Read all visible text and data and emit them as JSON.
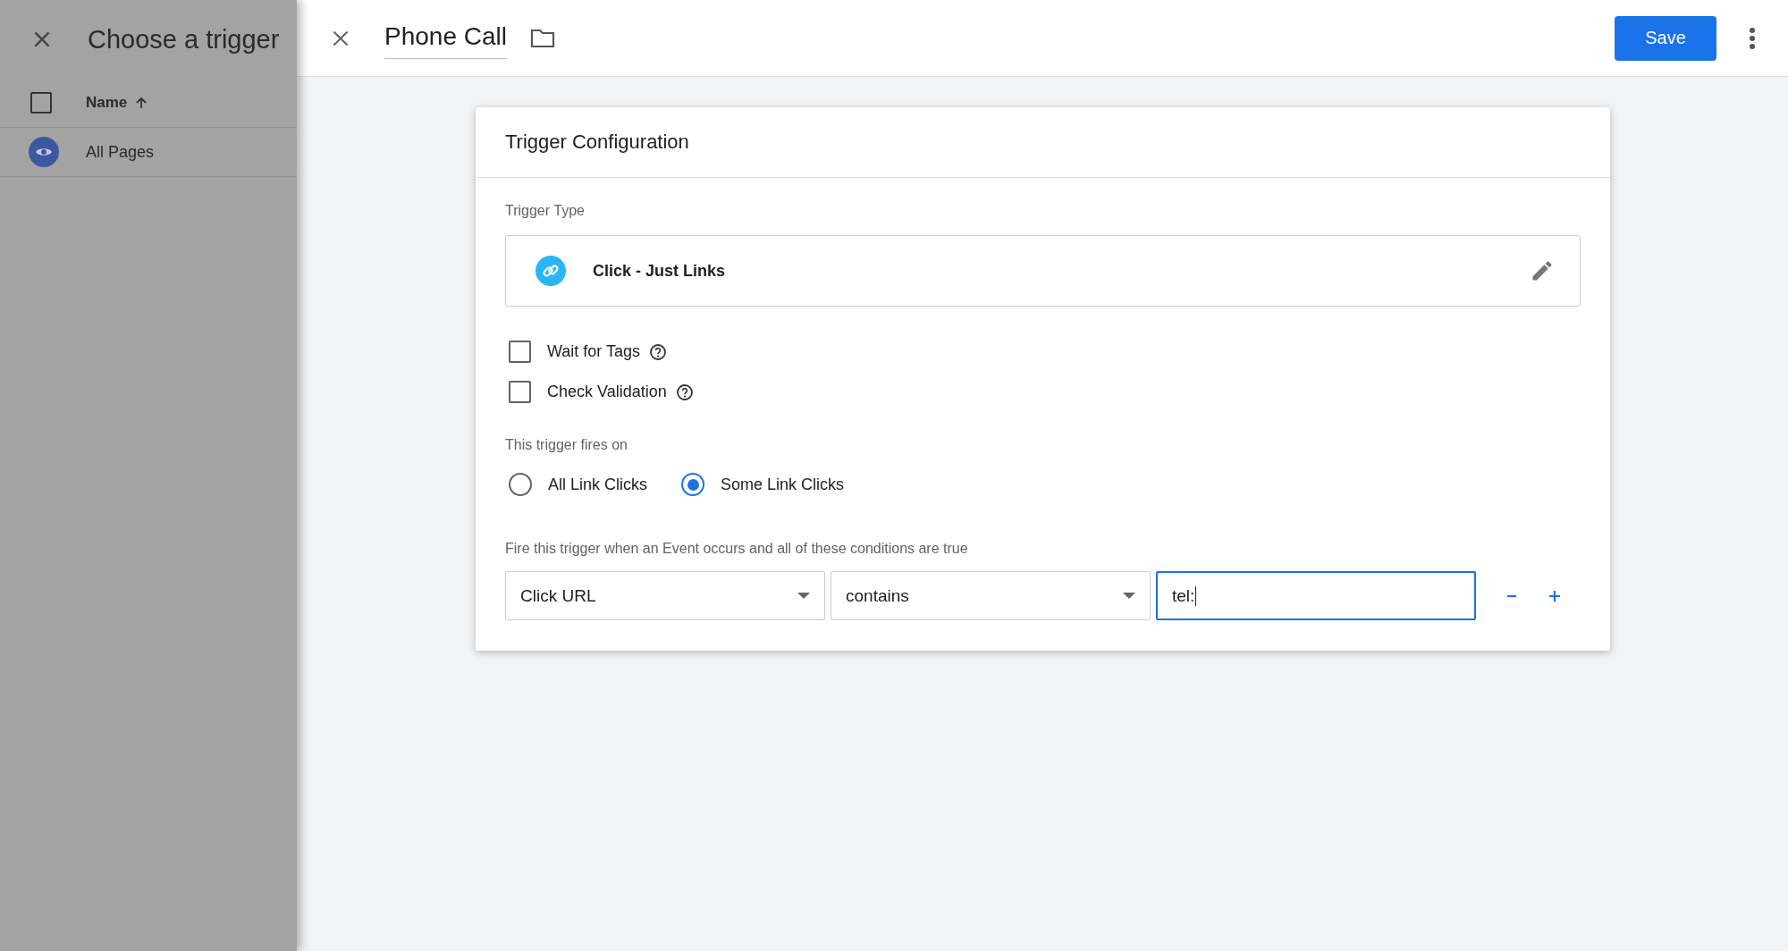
{
  "trigger_list": {
    "title": "Choose a trigger",
    "select_all": {
      "checked": false
    },
    "column": "Name",
    "rows": [
      {
        "name": "All Pages"
      }
    ]
  },
  "editor": {
    "title": "Phone Call",
    "save": "Save"
  },
  "card": {
    "title": "Trigger Configuration",
    "trigger_type_label": "Trigger Type",
    "trigger_type": "Click - Just Links",
    "options": [
      {
        "label": "Wait for Tags",
        "checked": false
      },
      {
        "label": "Check Validation",
        "checked": false
      }
    ],
    "fires_on_label": "This trigger fires on",
    "fires_on": [
      {
        "label": "All Link Clicks",
        "selected": false
      },
      {
        "label": "Some Link Clicks",
        "selected": true
      }
    ],
    "condition_label": "Fire this trigger when an Event occurs and all of these conditions are true",
    "conditions": [
      {
        "variable": "Click URL",
        "operator": "contains",
        "value": "tel:"
      }
    ]
  }
}
